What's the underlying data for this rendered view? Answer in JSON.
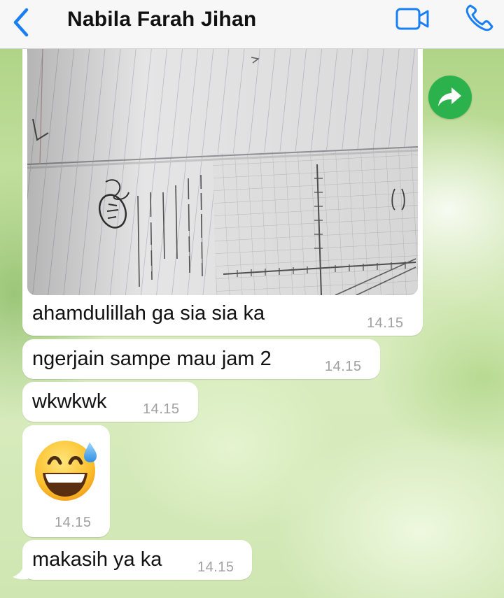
{
  "header": {
    "contact_name": "Nabila Farah Jihan"
  },
  "icons": {
    "back": "chevron-left-icon",
    "video": "video-camera-icon",
    "phone": "phone-icon",
    "forward": "forward-arrow-icon",
    "emoji": "grinning-face-with-sweat-emoji"
  },
  "colors": {
    "accent": "#1a7ff3",
    "forward_button": "#2bb24c",
    "bubble": "#ffffff",
    "timestamp": "#a0a0a0"
  },
  "messages": [
    {
      "type": "image",
      "caption": "ahamdulillah ga sia sia ka",
      "time": "14.15"
    },
    {
      "type": "text",
      "text": "ngerjain sampe mau jam 2",
      "time": "14.15"
    },
    {
      "type": "text",
      "text": "wkwkwk",
      "time": "14.15"
    },
    {
      "type": "emoji",
      "emoji": "😅",
      "time": "14.15"
    },
    {
      "type": "text",
      "text": "makasih ya ka",
      "time": "14.15"
    }
  ]
}
